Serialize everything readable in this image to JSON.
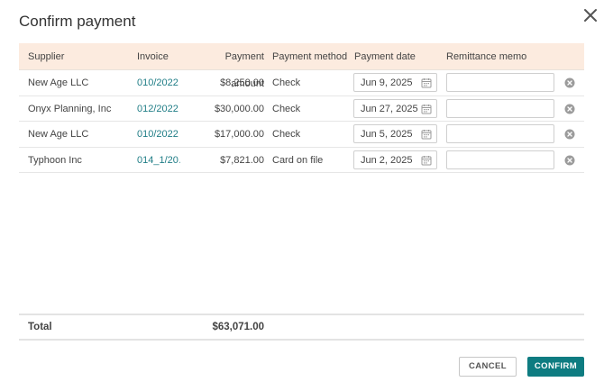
{
  "dialog": {
    "title": "Confirm payment"
  },
  "table": {
    "headers": {
      "supplier": "Supplier",
      "invoice": "Invoice",
      "amount": "Payment amount",
      "method": "Payment method",
      "date": "Payment date",
      "memo": "Remittance memo"
    },
    "rows": [
      {
        "supplier": "New Age LLC",
        "invoice": "010/2022",
        "amount": "$8,250.00",
        "method": "Check",
        "date": "Jun 9, 2025",
        "memo": ""
      },
      {
        "supplier": "Onyx Planning, Inc",
        "invoice": "012/2022",
        "amount": "$30,000.00",
        "method": "Check",
        "date": "Jun 27, 2025",
        "memo": ""
      },
      {
        "supplier": "New Age LLC",
        "invoice": "010/2022",
        "amount": "$17,000.00",
        "method": "Check",
        "date": "Jun 5, 2025",
        "memo": ""
      },
      {
        "supplier": "Typhoon Inc",
        "invoice": "014_1/20…",
        "amount": "$7,821.00",
        "method": "Card on file",
        "date": "Jun 2, 2025",
        "memo": ""
      }
    ]
  },
  "total": {
    "label": "Total",
    "amount": "$63,071.00"
  },
  "footer": {
    "cancel_label": "CANCEL",
    "confirm_label": "CONFIRM"
  },
  "colors": {
    "header_bg": "#fcebdf",
    "link": "#1f7d86",
    "primary": "#0e7c81"
  },
  "icons": {
    "close": "close-icon",
    "calendar": "calendar-icon",
    "remove": "remove-circle-icon"
  }
}
